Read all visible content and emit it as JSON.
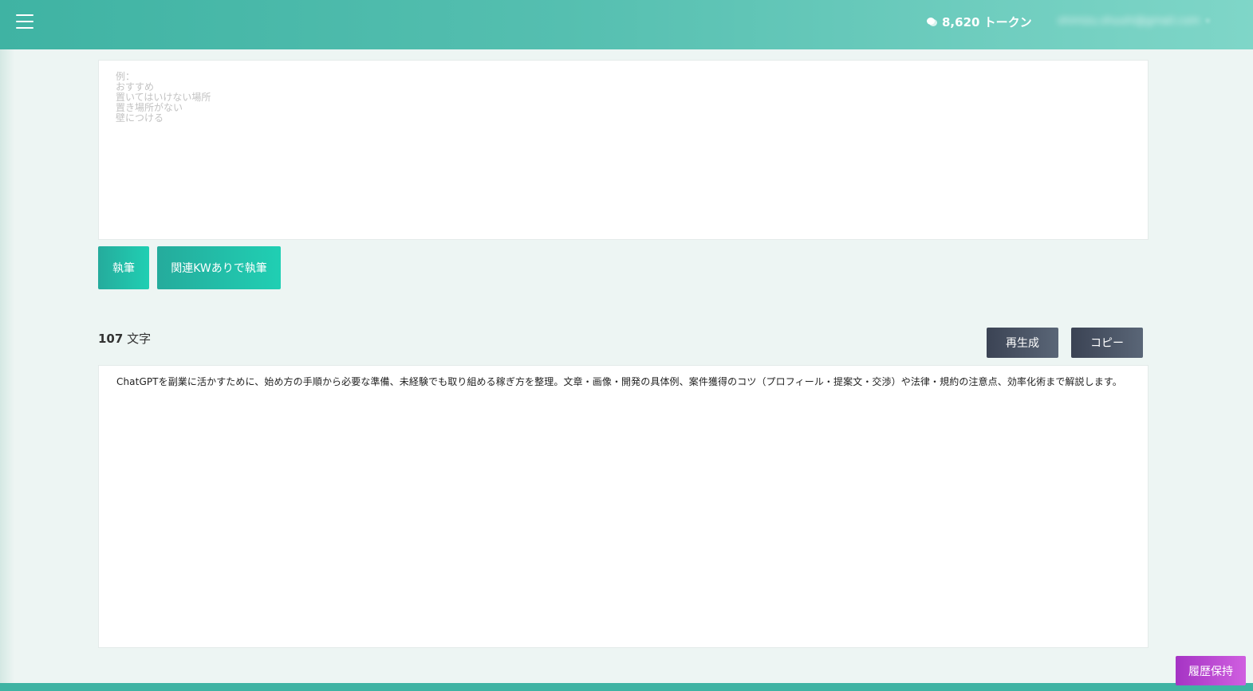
{
  "header": {
    "menu_icon": "hamburger-menu-icon",
    "token_icon": "chat-bubble-icon",
    "token_count": "8,620 トークン",
    "user_email": "shimizu.shuuhi@gmail.com",
    "user_caret": "▾"
  },
  "keyword_input": {
    "placeholder": "例：\nおすすめ\n置いてはいけない場所\n置き場所がない\n壁につける",
    "value": ""
  },
  "actions": {
    "write_label": "執筆",
    "write_with_kw_label": "関連KWありで執筆"
  },
  "result": {
    "char_count": "107",
    "char_unit": "文字",
    "regenerate_label": "再生成",
    "copy_label": "コピー",
    "output_text": "ChatGPTを副業に活かすために、始め方の手順から必要な準備、未経験でも取り組める稼ぎ方を整理。文章・画像・開発の具体例、案件獲得のコツ（プロフィール・提案文・交渉）や法律・規約の注意点、効率化術まで解説します。"
  },
  "footer": {
    "history_label": "履歴保持"
  },
  "colors": {
    "header_start": "#3fb3a3",
    "header_end": "#7fd6c8",
    "teal_button": "#20cfb3",
    "dark_button": "#3b4354",
    "history_button": "#a534c4",
    "page_background": "#edf5f3"
  }
}
